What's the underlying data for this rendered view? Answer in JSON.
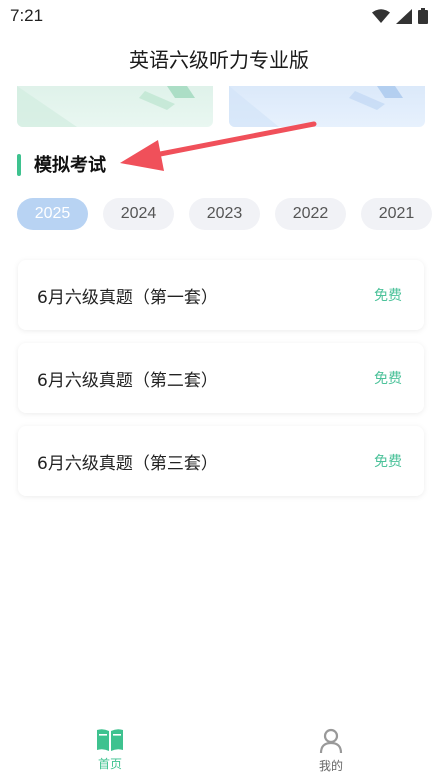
{
  "status_bar": {
    "time": "7:21"
  },
  "app": {
    "title": "英语六级听力专业版"
  },
  "section": {
    "title": "模拟考试"
  },
  "years": {
    "selected": "2025",
    "items": [
      "2025",
      "2024",
      "2023",
      "2022",
      "2021"
    ]
  },
  "exams": [
    {
      "title": "6月六级真题（第一套）",
      "badge": "免费"
    },
    {
      "title": "6月六级真题（第二套）",
      "badge": "免费"
    },
    {
      "title": "6月六级真题（第三套）",
      "badge": "免费"
    }
  ],
  "tabs": [
    {
      "label": "首页",
      "icon": "book-icon",
      "active": true
    },
    {
      "label": "我的",
      "icon": "person-icon",
      "active": false
    }
  ],
  "colors": {
    "accent": "#3ec28f",
    "chip_active": "#b8d3f3",
    "arrow": "#f0505a"
  }
}
